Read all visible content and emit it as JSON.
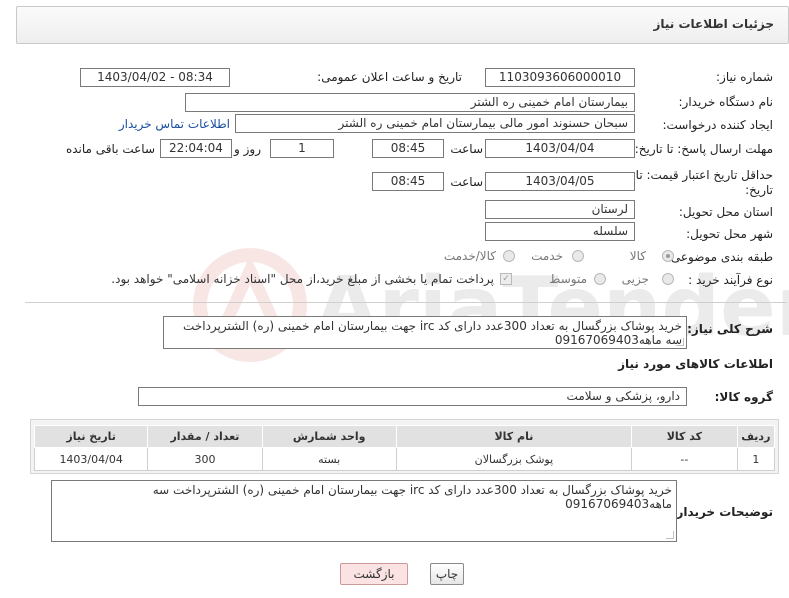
{
  "header": {
    "title": "جزئیات اطلاعات نیاز"
  },
  "fields": {
    "need_number_label": "شماره نیاز:",
    "need_number": "1103093606000010",
    "announce_label": "تاریخ و ساعت اعلان عمومی:",
    "announce_value": "1403/04/02 - 08:34",
    "buyer_org_label": "نام دستگاه خریدار:",
    "buyer_org": "بیمارستان امام خمینی ره الشتر",
    "requester_label": "ایجاد کننده درخواست:",
    "requester": "سبحان حسنوند امور مالی بیمارستان امام خمینی ره الشتر",
    "contact_link": "اطلاعات تماس خریدار",
    "deadline_label": "مهلت ارسال پاسخ: تا تاریخ:",
    "deadline_date": "1403/04/04",
    "time_label": "ساعت",
    "deadline_time": "08:45",
    "days_value": "1",
    "days_label": "روز و",
    "remaining_value": "22:04:04",
    "remaining_label": "ساعت باقی مانده",
    "validity_label": "حداقل تاریخ اعتبار قیمت: تا تاریخ:",
    "validity_date": "1403/04/05",
    "validity_time": "08:45",
    "province_label": "استان محل تحویل:",
    "province": "لرستان",
    "city_label": "شهر محل تحویل:",
    "city": "سلسله",
    "category_label": "طبقه بندی موضوعی:",
    "category_options": [
      "کالا",
      "خدمت",
      "کالا/خدمت"
    ],
    "process_label": "نوع فرآیند خرید :",
    "process_options": [
      "جزیی",
      "متوسط"
    ],
    "payment_note": "پرداخت تمام یا بخشی از مبلغ خرید،از محل \"اسناد خزانه اسلامی\" خواهد بود."
  },
  "summary": {
    "label": "شرح کلی نیاز:",
    "text": "خرید پوشاک بزرگسال به تعداد 300عدد دارای کد irc  جهت بیمارستان امام خمینی (ره) الشترپرداخت سه ماهه09167069403"
  },
  "goods_section": {
    "title": "اطلاعات کالاهای مورد نیاز",
    "group_label": "گروه کالا:",
    "group_value": "دارو، پزشکی و سلامت"
  },
  "table": {
    "headers": [
      "ردیف",
      "کد کالا",
      "نام کالا",
      "واحد شمارش",
      "تعداد / مقدار",
      "تاریخ نیاز"
    ],
    "rows": [
      [
        "1",
        "--",
        "پوشک بزرگسالان",
        "بسته",
        "300",
        "1403/04/04"
      ]
    ]
  },
  "buyer_notes": {
    "label": "توضیحات خریدار:",
    "text": "خرید پوشاک بزرگسال به تعداد 300عدد دارای کد irc  جهت بیمارستان امام خمینی (ره) الشترپرداخت سه ماهه09167069403"
  },
  "buttons": {
    "print": "چاپ",
    "back": "بازگشت"
  },
  "watermark": {
    "text": "AriaTender.neT"
  }
}
